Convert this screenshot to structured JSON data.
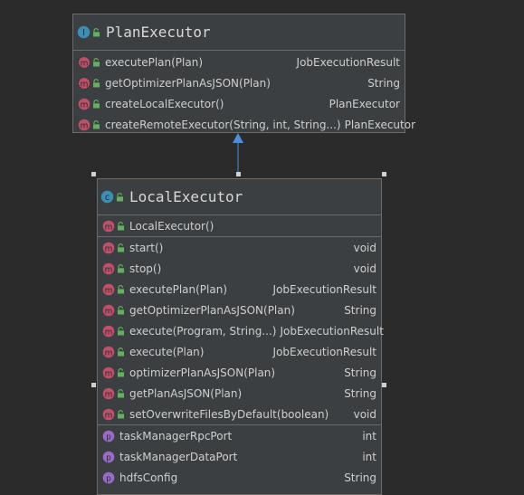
{
  "colors": {
    "background": "#2b2b2b",
    "class_fill": "#3c3f41",
    "border": "#6b6b6b",
    "method_icon": "#c0506a",
    "property_icon": "#9a6bc9",
    "class_icon": "#3a8fb7",
    "interface_icon": "#3a8fb7",
    "visibility_public": "#63b060",
    "arrow": "#4b8fd8"
  },
  "plan_executor": {
    "kind_icon": "interface-icon",
    "title": "PlanExecutor",
    "methods": [
      {
        "name": "executePlan(Plan)",
        "type": "JobExecutionResult",
        "icon": "abstract-method-icon"
      },
      {
        "name": "getOptimizerPlanAsJSON(Plan)",
        "type": "String",
        "icon": "abstract-method-icon"
      },
      {
        "name": "createLocalExecutor()",
        "type": "PlanExecutor",
        "icon": "method-icon"
      },
      {
        "name": "createRemoteExecutor(String, int, String...)",
        "type": "PlanExecutor",
        "icon": "method-icon"
      }
    ]
  },
  "local_executor": {
    "kind_icon": "class-icon",
    "title": "LocalExecutor",
    "constructors": [
      {
        "name": "LocalExecutor()",
        "type": "",
        "icon": "method-icon"
      }
    ],
    "methods": [
      {
        "name": "start()",
        "type": "void",
        "icon": "method-icon"
      },
      {
        "name": "stop()",
        "type": "void",
        "icon": "method-icon"
      },
      {
        "name": "executePlan(Plan)",
        "type": "JobExecutionResult",
        "icon": "method-icon"
      },
      {
        "name": "getOptimizerPlanAsJSON(Plan)",
        "type": "String",
        "icon": "method-icon"
      },
      {
        "name": "execute(Program, String...)",
        "type": "JobExecutionResult",
        "icon": "method-icon"
      },
      {
        "name": "execute(Plan)",
        "type": "JobExecutionResult",
        "icon": "method-icon"
      },
      {
        "name": "optimizerPlanAsJSON(Plan)",
        "type": "String",
        "icon": "method-icon"
      },
      {
        "name": "getPlanAsJSON(Plan)",
        "type": "String",
        "icon": "method-icon"
      },
      {
        "name": "setOverwriteFilesByDefault(boolean)",
        "type": "void",
        "icon": "method-icon"
      }
    ],
    "properties": [
      {
        "name": "taskManagerRpcPort",
        "type": "int",
        "icon": "property-icon"
      },
      {
        "name": "taskManagerDataPort",
        "type": "int",
        "icon": "property-icon"
      },
      {
        "name": "hdfsConfig",
        "type": "String",
        "icon": "property-icon"
      }
    ]
  }
}
